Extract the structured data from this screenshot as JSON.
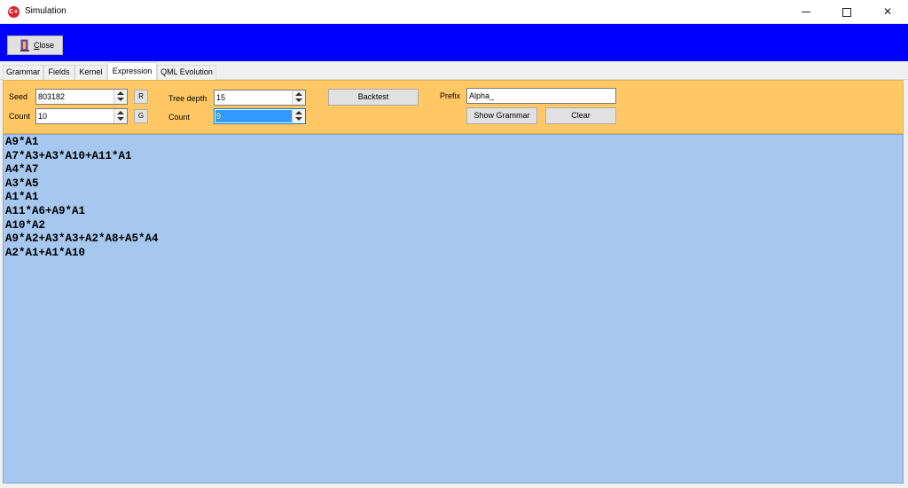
{
  "window": {
    "title": "Simulation",
    "app_icon_text": "C+"
  },
  "toolbar": {
    "close_label_underlined": "C",
    "close_label_rest": "lose"
  },
  "tabs": [
    {
      "label": "Grammar",
      "active": false
    },
    {
      "label": "Fields",
      "active": false
    },
    {
      "label": "Kernel",
      "active": false
    },
    {
      "label": "Expression",
      "active": true
    },
    {
      "label": "QML Evolution",
      "active": false
    }
  ],
  "controls": {
    "seed_label": "Seed",
    "seed_value": "803182",
    "count_label": "Count",
    "count_value": "10",
    "r_button": "R",
    "g_button": "G",
    "tree_depth_label": "Tree depth",
    "tree_depth_value": "15",
    "count2_label": "Count",
    "count2_value": "9",
    "backtest_button": "Backtest",
    "prefix_label": "Prefix",
    "prefix_value": "Alpha_",
    "show_grammar_button": "Show Grammar",
    "clear_button": "Clear"
  },
  "output": {
    "lines": [
      "A9*A1",
      "A7*A3+A3*A10+A11*A1",
      "A4*A7",
      "A3*A5",
      "A1*A1",
      "A11*A6+A9*A1",
      "A10*A2",
      "A9*A2+A3*A3+A2*A8+A5*A4",
      "A2*A1+A1*A10"
    ]
  },
  "colors": {
    "toolbar_bg": "#0000ff",
    "panel_bg": "#ffc864",
    "output_bg": "#a6c8ee"
  }
}
